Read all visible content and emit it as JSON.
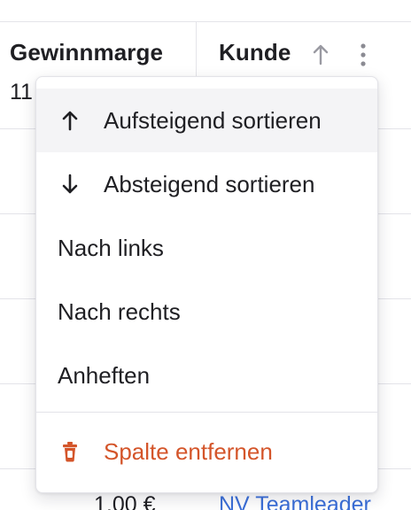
{
  "table": {
    "columns": [
      {
        "header": "Gewinnmarge",
        "visible_value": "11"
      },
      {
        "header": "Kunde"
      }
    ],
    "last_row": {
      "amount": "1,00 €",
      "customer": "NV Teamleader"
    }
  },
  "column_menu": {
    "items": [
      {
        "label": "Aufsteigend sortieren",
        "icon": "arrow-up-icon"
      },
      {
        "label": "Absteigend sortieren",
        "icon": "arrow-down-icon"
      },
      {
        "label": "Nach links"
      },
      {
        "label": "Nach rechts"
      },
      {
        "label": "Anheften"
      }
    ],
    "danger_item": {
      "label": "Spalte entfernen",
      "icon": "trash-icon"
    }
  },
  "colors": {
    "danger": "#d4552a",
    "link": "#3b6fd8",
    "hover": "#f4f4f6",
    "border": "#e4e4e9"
  }
}
